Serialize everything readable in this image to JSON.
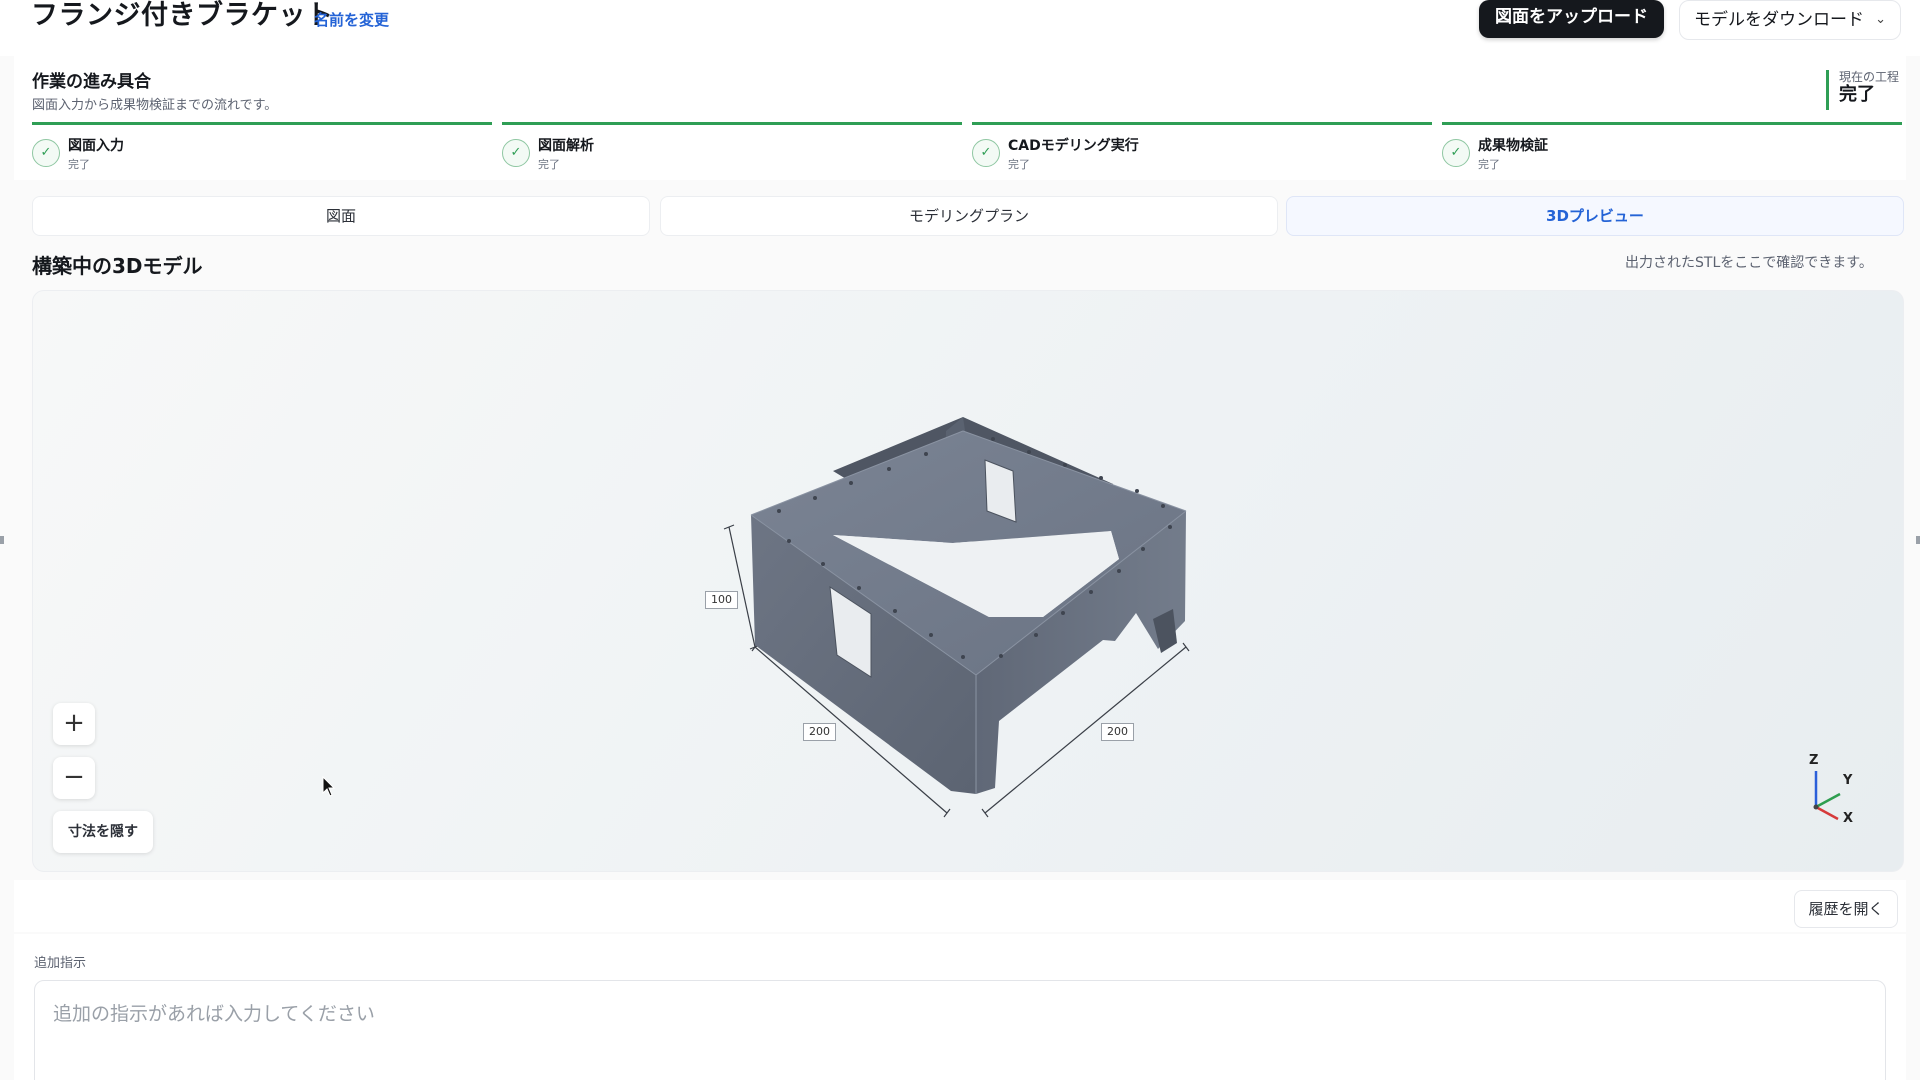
{
  "header": {
    "title": "フランジ付きブラケット",
    "rename_label": "名前を変更",
    "upload_label": "図面をアップロード",
    "download_label": "モデルをダウンロード"
  },
  "progress": {
    "title": "作業の進み具合",
    "subtitle": "図面入力から成果物検証までの流れです。",
    "current_label": "現在の工程",
    "current_value": "完了",
    "steps": [
      {
        "name": "図面入力",
        "state": "完了"
      },
      {
        "name": "図面解析",
        "state": "完了"
      },
      {
        "name": "CADモデリング実行",
        "state": "完了"
      },
      {
        "name": "成果物検証",
        "state": "完了"
      }
    ]
  },
  "tabs": [
    {
      "label": "図面"
    },
    {
      "label": "モデリングプラン"
    },
    {
      "label": "3Dプレビュー"
    }
  ],
  "active_tab": "3Dプレビュー",
  "preview": {
    "title": "構築中の3Dモデル",
    "hint": "出力されたSTLをここで確認できます。",
    "dimensions": [
      "100",
      "200",
      "200"
    ],
    "zoom_in": "+",
    "zoom_out": "−",
    "toggle_dims": "寸法を隠す",
    "axes": {
      "z": "Z",
      "y": "Y",
      "x": "X"
    }
  },
  "history_label": "履歴を開く",
  "instructions": {
    "label": "追加指示",
    "placeholder": "追加の指示があれば入力してください"
  },
  "icons": {
    "check": "check-icon",
    "chevron": "chevron-down-icon",
    "cursor": "mouse-pointer-icon",
    "gizmo": "axis-gizmo-icon"
  },
  "colors": {
    "accent": "#2463d6",
    "progress_green": "#2f9e55",
    "dark_button": "#15181d",
    "model_gray": "#6d7685"
  }
}
